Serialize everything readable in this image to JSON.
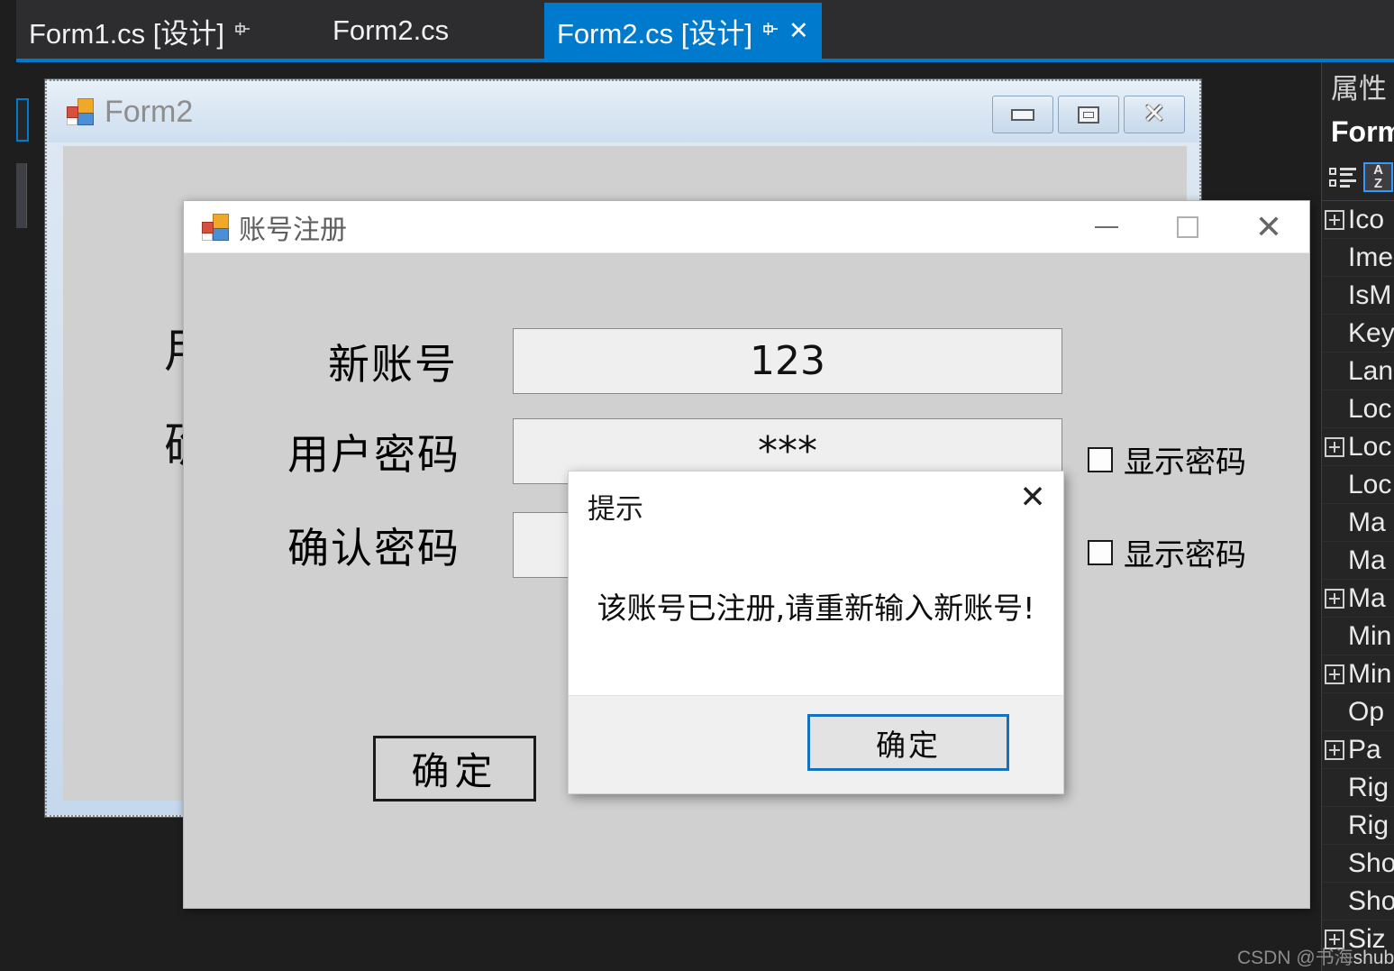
{
  "ide": {
    "tabs": [
      {
        "label": "Form1.cs [设计]",
        "active": false,
        "pin": "⊞",
        "has_close": false
      },
      {
        "label": "Form2.cs",
        "active": false,
        "pin": "",
        "has_close": false
      },
      {
        "label": "Form2.cs [设计]",
        "active": true,
        "pin": "⊞",
        "has_close": true,
        "close": "✕"
      }
    ],
    "accent_color": "#007acc"
  },
  "designer": {
    "form_window": {
      "title": "Form2",
      "icon": "form-icon",
      "buttons": {
        "minimize": "minimize-icon",
        "maximize": "maximize-icon",
        "close": "✕"
      },
      "ghost_labels": [
        "用",
        "确"
      ]
    }
  },
  "register_dialog": {
    "title": "账号注册",
    "icon": "form-icon",
    "window_buttons": {
      "minimize": "minimize-icon",
      "maximize": "maximize-icon",
      "close": "✕"
    },
    "fields": [
      {
        "label": "新账号",
        "value": "123",
        "show_checkbox": false,
        "checkbox_label": ""
      },
      {
        "label": "用户密码",
        "value": "***",
        "show_checkbox": true,
        "checkbox_label": "显示密码",
        "checked": false
      },
      {
        "label": "确认密码",
        "value": "",
        "show_checkbox": true,
        "checkbox_label": "显示密码",
        "checked": false
      }
    ],
    "confirm_button": "确定"
  },
  "message_box": {
    "title": "提示",
    "message": "该账号已注册,请重新输入新账号!",
    "ok_button": "确定",
    "close": "✕",
    "focus_color": "#1471bd"
  },
  "properties_panel": {
    "header": "属性",
    "subject": "Form",
    "toolbar": [
      {
        "name": "categorized-view-icon",
        "selected": false
      },
      {
        "name": "alphabetical-sort-icon",
        "label_top": "A",
        "label_bottom": "Z",
        "selected": true
      }
    ],
    "rows": [
      {
        "name": "Ico",
        "expandable": true
      },
      {
        "name": "Ime",
        "expandable": false
      },
      {
        "name": "IsM",
        "expandable": false
      },
      {
        "name": "Key",
        "expandable": false
      },
      {
        "name": "Lan",
        "expandable": false
      },
      {
        "name": "Loc",
        "expandable": false
      },
      {
        "name": "Loc",
        "expandable": true
      },
      {
        "name": "Loc",
        "expandable": false
      },
      {
        "name": "Ma",
        "expandable": false
      },
      {
        "name": "Ma",
        "expandable": false
      },
      {
        "name": "Ma",
        "expandable": true
      },
      {
        "name": "Min",
        "expandable": false
      },
      {
        "name": "Min",
        "expandable": true
      },
      {
        "name": "Op",
        "expandable": false
      },
      {
        "name": "Pa",
        "expandable": true
      },
      {
        "name": "Rig",
        "expandable": false
      },
      {
        "name": "Rig",
        "expandable": false
      },
      {
        "name": "Sho",
        "expandable": false
      },
      {
        "name": "Sho",
        "expandable": false
      },
      {
        "name": "Siz",
        "expandable": true
      }
    ]
  },
  "watermark": {
    "prefix": "CSDN @书海",
    "suffix": "shubai"
  }
}
